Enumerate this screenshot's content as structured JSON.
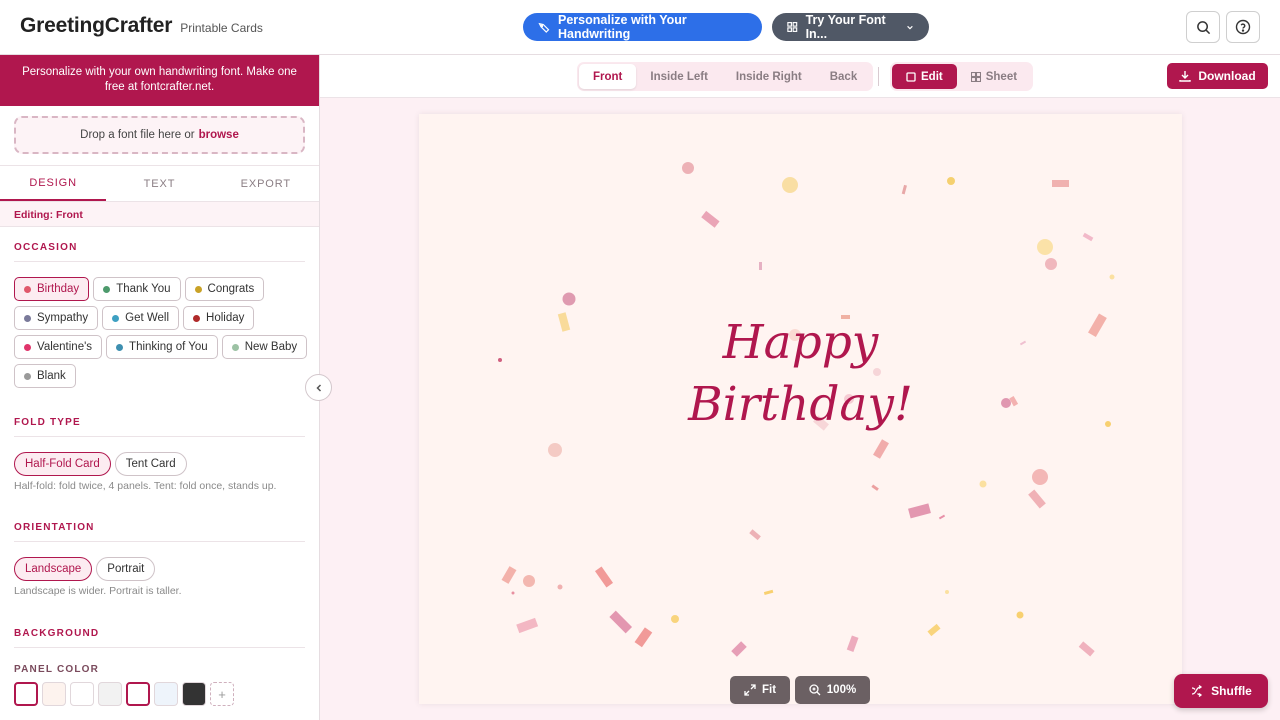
{
  "header": {
    "brand": "GreetingCrafter",
    "tagline": "Printable Cards",
    "personalize_button": "Personalize with Your Handwriting",
    "try_font_button": "Try Your Font In..."
  },
  "sidebar": {
    "promo": "Personalize with your own handwriting font. Make one free at fontcrafter.net.",
    "dropzone_text": "Drop a font file here or",
    "dropzone_link": "browse",
    "tabs": [
      "DESIGN",
      "TEXT",
      "EXPORT"
    ],
    "editing_label": "Editing: Front",
    "occasion": {
      "title": "OCCASION",
      "options": [
        {
          "label": "Birthday",
          "color": "#e0576b"
        },
        {
          "label": "Thank You",
          "color": "#4d9a6c"
        },
        {
          "label": "Congrats",
          "color": "#c9a227"
        },
        {
          "label": "Sympathy",
          "color": "#7a7a9a"
        },
        {
          "label": "Get Well",
          "color": "#3ea0c2"
        },
        {
          "label": "Holiday",
          "color": "#b02a2a"
        },
        {
          "label": "Valentine's",
          "color": "#e0346b"
        },
        {
          "label": "Thinking of You",
          "color": "#3e8fb0"
        },
        {
          "label": "New Baby",
          "color": "#9cc2a4"
        },
        {
          "label": "Blank",
          "color": "#9a9a9a"
        }
      ],
      "selected": "Birthday"
    },
    "fold": {
      "title": "FOLD TYPE",
      "options": [
        "Half-Fold Card",
        "Tent Card"
      ],
      "selected": "Half-Fold Card",
      "hint": "Half-fold: fold twice, 4 panels. Tent: fold once, stands up."
    },
    "orientation": {
      "title": "ORIENTATION",
      "options": [
        "Landscape",
        "Portrait"
      ],
      "selected": "Landscape",
      "hint": "Landscape is wider. Portrait is taller."
    },
    "background": {
      "title": "BACKGROUND",
      "panel_color_label": "PANEL COLOR",
      "swatches": [
        "#ffffff",
        "#fdf3ee",
        "#ffffff",
        "#f2f2f2",
        "#ffffff",
        "#eef4fb",
        "#333333"
      ],
      "add_symbol": "+"
    }
  },
  "toolbar": {
    "panels": [
      "Front",
      "Inside Left",
      "Inside Right",
      "Back"
    ],
    "selected_panel": "Front",
    "modes": [
      "Edit",
      "Sheet"
    ],
    "selected_mode": "Edit",
    "download": "Download"
  },
  "card": {
    "line1": "Happy",
    "line2": "Birthday!",
    "background": "#fff4f1"
  },
  "controls": {
    "fit": "Fit",
    "zoom": "100%",
    "shuffle": "Shuffle"
  },
  "colors": {
    "brand": "#b0174e",
    "blue": "#2d6fe8"
  }
}
